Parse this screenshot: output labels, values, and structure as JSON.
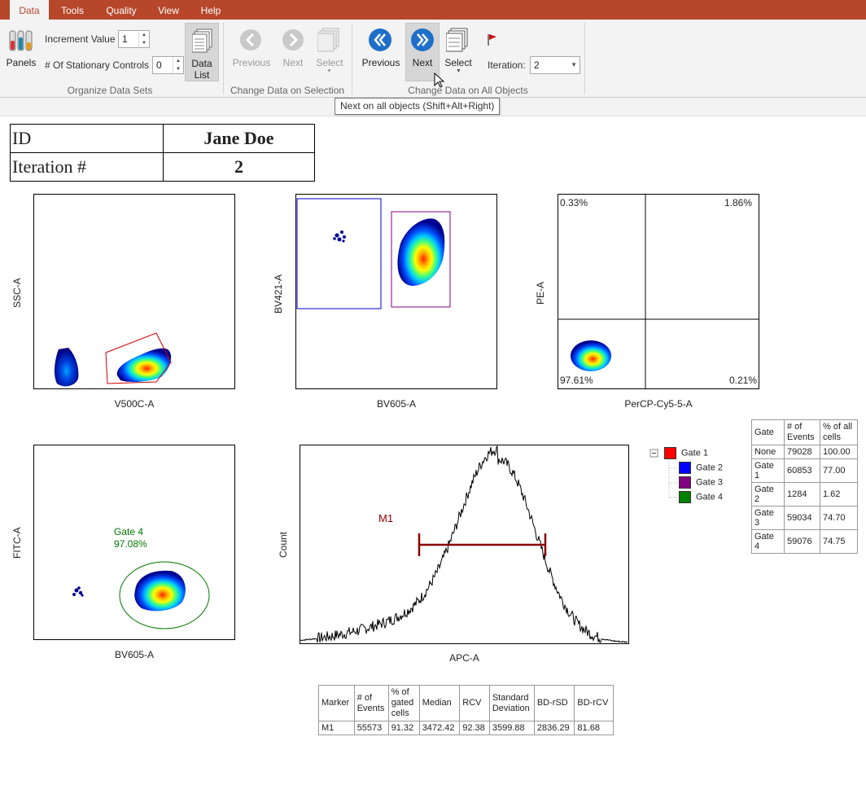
{
  "menu": {
    "items": [
      "Data",
      "Tools",
      "Quality",
      "View",
      "Help"
    ],
    "active": "Data"
  },
  "ribbon": {
    "panels_label": "Panels",
    "increment_label": "Increment Value",
    "increment_value": "1",
    "stationary_label": "# Of Stationary Controls",
    "stationary_value": "0",
    "data_list_label_1": "Data",
    "data_list_label_2": "List",
    "group_organize": "Organize Data Sets",
    "sel_previous": "Previous",
    "sel_next": "Next",
    "sel_select": "Select",
    "group_change_selection": "Change Data on Selection",
    "all_previous": "Previous",
    "all_next": "Next",
    "all_select": "Select",
    "iteration_label": "Iteration:",
    "iteration_value": "2",
    "group_change_all": "Change Data on All Objects"
  },
  "tooltip": "Next on all objects (Shift+Alt+Right)",
  "id_table": {
    "id_label": "ID",
    "id_value": "Jane Doe",
    "iter_label": "Iteration #",
    "iter_value": "2"
  },
  "plots": {
    "p1": {
      "xlabel": "V500C-A",
      "ylabel": "SSC-A"
    },
    "p2": {
      "xlabel": "BV605-A",
      "ylabel": "BV421-A"
    },
    "p3": {
      "xlabel": "PerCP-Cy5-5-A",
      "ylabel": "PE-A",
      "q_ul": "0.33%",
      "q_ur": "1.86%",
      "q_ll": "97.61%",
      "q_lr": "0.21%"
    },
    "p4": {
      "xlabel": "BV605-A",
      "ylabel": "FITC-A",
      "gate_name": "Gate 4",
      "gate_pct": "97.08%"
    },
    "p5": {
      "xlabel": "APC-A",
      "ylabel": "Count",
      "marker": "M1"
    }
  },
  "gate_tree": [
    {
      "name": "Gate 1",
      "color": "#ff0000"
    },
    {
      "name": "Gate 2",
      "color": "#0000ff"
    },
    {
      "name": "Gate 3",
      "color": "#800080"
    },
    {
      "name": "Gate 4",
      "color": "#008000"
    }
  ],
  "gate_table": {
    "headers": [
      "Gate",
      "# of Events",
      "% of all cells"
    ],
    "rows": [
      [
        "None",
        "79028",
        "100.00"
      ],
      [
        "Gate 1",
        "60853",
        "77.00"
      ],
      [
        "Gate 2",
        "1284",
        "1.62"
      ],
      [
        "Gate 3",
        "59034",
        "74.70"
      ],
      [
        "Gate 4",
        "59076",
        "74.75"
      ]
    ]
  },
  "marker_table": {
    "headers": [
      "Marker",
      "# of Events",
      "% of gated cells",
      "Median",
      "RCV",
      "Standard Deviation",
      "BD-rSD",
      "BD-rCV"
    ],
    "rows": [
      [
        "M1",
        "55573",
        "91.32",
        "3472.42",
        "92.38",
        "3599.88",
        "2836.29",
        "81.68"
      ]
    ]
  },
  "colors": {
    "menubar": "#b6472b",
    "ribbon_icon_blue": "#1e6fc9",
    "gate1": "#cc0000",
    "gate2": "#0000cc",
    "gate3": "#800080",
    "gate4": "#007700",
    "marker": "#8b0000"
  }
}
